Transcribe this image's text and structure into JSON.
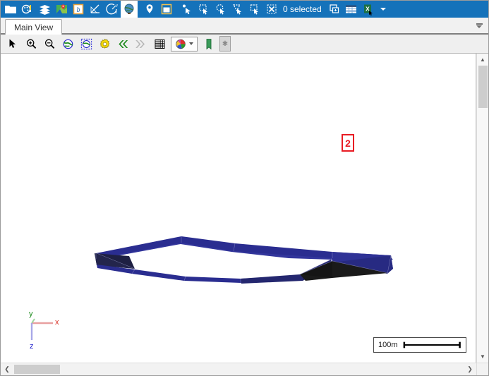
{
  "ribbon": {
    "items": [
      {
        "name": "open-folder-icon",
        "icon": "folder"
      },
      {
        "name": "symbology-icon",
        "icon": "palette-brush"
      },
      {
        "name": "layers-icon",
        "icon": "layers"
      },
      {
        "name": "map-icon",
        "icon": "map-pin-map"
      },
      {
        "name": "basemap-icon",
        "icon": "basemap-b"
      },
      {
        "name": "measure-angle-icon",
        "icon": "angle"
      },
      {
        "name": "rotate-axis-icon",
        "icon": "rotate-axis"
      },
      {
        "name": "globe-icon",
        "icon": "globe",
        "selected": true
      },
      {
        "name": "place-marker-icon",
        "icon": "pin"
      },
      {
        "name": "window-layout-icon",
        "icon": "window"
      },
      {
        "name": "select-point-icon",
        "icon": "select-point"
      },
      {
        "name": "select-rectangle-icon",
        "icon": "select-rect"
      },
      {
        "name": "select-circle-icon",
        "icon": "select-circle"
      },
      {
        "name": "select-polygon-icon",
        "icon": "select-poly"
      },
      {
        "name": "select-box-icon",
        "icon": "select-box"
      },
      {
        "name": "clear-selection-icon",
        "icon": "clear-select"
      }
    ],
    "selection_status": "0 selected",
    "right_items": [
      {
        "name": "duplicate-view-icon",
        "icon": "duplicate"
      },
      {
        "name": "table-view-icon",
        "icon": "table"
      },
      {
        "name": "export-excel-icon",
        "icon": "excel"
      }
    ],
    "overflow_label": "more-options"
  },
  "tabs": {
    "items": [
      {
        "label": "Main View",
        "active": true
      }
    ],
    "overflow_name": "tab-list-dropdown"
  },
  "viewtools": {
    "items": [
      {
        "name": "pointer-tool",
        "icon": "arrow"
      },
      {
        "name": "zoom-in-tool",
        "icon": "zoom-in"
      },
      {
        "name": "zoom-out-tool",
        "icon": "zoom-out"
      },
      {
        "name": "zoom-extent-tool",
        "icon": "globe-blue"
      },
      {
        "name": "zoom-selection-tool",
        "icon": "globe-dashed"
      },
      {
        "name": "view-settings-tool",
        "icon": "gear"
      },
      {
        "name": "previous-view-tool",
        "icon": "chevrons-left"
      },
      {
        "name": "next-view-tool",
        "icon": "chevrons-right"
      },
      {
        "name": "grid-toggle-tool",
        "icon": "grid"
      },
      {
        "name": "color-palette-tool",
        "icon": "palette"
      },
      {
        "name": "bookmark-tool",
        "icon": "bookmark"
      },
      {
        "name": "toolbar-overflow",
        "icon": "asterisk"
      }
    ]
  },
  "canvas": {
    "annotation_badge": "2",
    "axes": {
      "x_label": "x",
      "y_label": "y",
      "z_label": "z",
      "x_color": "#d93025",
      "y_color": "#1a8a1a",
      "z_color": "#2222cc"
    },
    "scalebar": {
      "label": "100m"
    },
    "model": {
      "name": "ring-shaped-3d-mesh",
      "face_color": "#2a2d90",
      "top_color": "#33369c",
      "shadow_color": "#22244e",
      "dark_cap_color": "#1c1e3e",
      "black_face_color": "#191919"
    }
  },
  "scrollbars": {
    "vertical_up": "▲",
    "vertical_down": "▼",
    "horizontal_left": "❮",
    "horizontal_right": "❯"
  }
}
